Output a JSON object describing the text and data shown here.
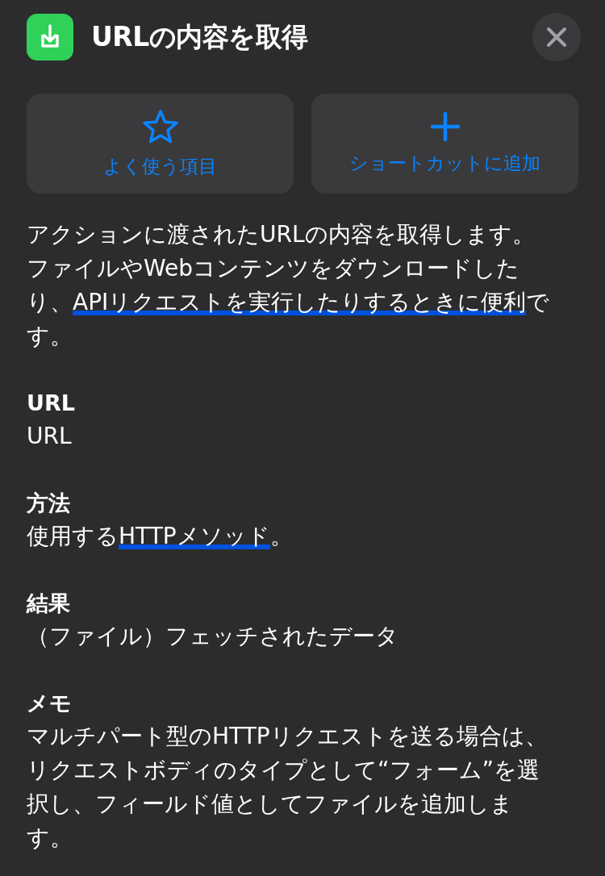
{
  "header": {
    "title": "URLの内容を取得"
  },
  "actions": [
    {
      "kind": "star",
      "label": "よく使う項目"
    },
    {
      "kind": "plus",
      "label": "ショートカットに追加"
    }
  ],
  "description": [
    {
      "text": "アクションに渡されたURLの内容を取得します。ファイルやWebコンテンツをダウンロードしたり、",
      "underlined": false
    },
    {
      "text": "APIリクエストを実行したりするときに便利",
      "underlined": true
    },
    {
      "text": "です。",
      "underlined": false
    }
  ],
  "sections": [
    {
      "heading": "URL",
      "body": [
        {
          "text": "URL",
          "underlined": false
        }
      ]
    },
    {
      "heading": "方法",
      "body": [
        {
          "text": "使用する",
          "underlined": false
        },
        {
          "text": "HTTPメソッド",
          "underlined": true
        },
        {
          "text": "。",
          "underlined": false
        }
      ]
    },
    {
      "heading": "結果",
      "body": [
        {
          "text": "（ファイル）フェッチされたデータ",
          "underlined": false
        }
      ]
    },
    {
      "heading": "メモ",
      "body": [
        {
          "text": "マルチパート型のHTTPリクエストを送る場合は、リクエストボディのタイプとして“フォーム”を選択し、フィールド値としてファイルを追加します。",
          "underlined": false
        }
      ]
    }
  ]
}
